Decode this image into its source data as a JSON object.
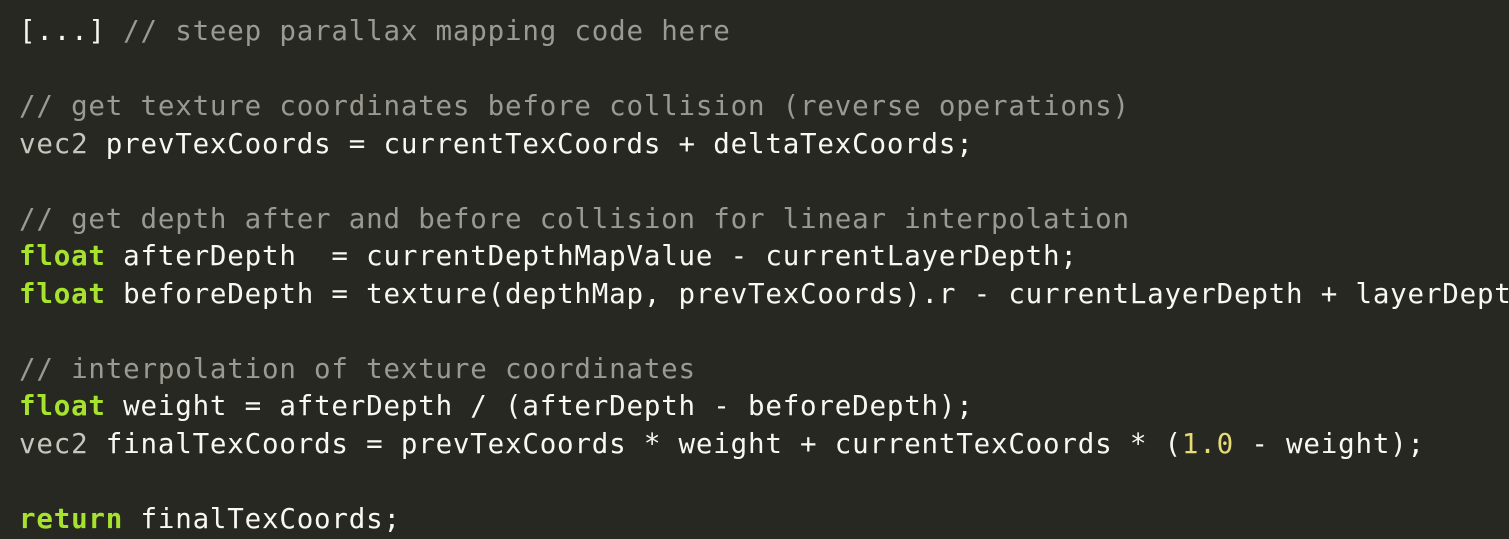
{
  "code_view": {
    "theme": {
      "background": "#272822",
      "comment": "#9a9a92",
      "type": "#c6c6bc",
      "keyword": "#a6e22e",
      "number": "#e6db74",
      "text": "#f8f8f2"
    },
    "lines": [
      [
        {
          "t": "[...] ",
          "k": "plain"
        },
        {
          "t": "// steep parallax mapping code here",
          "k": "comment"
        }
      ],
      [],
      [
        {
          "t": "// get texture coordinates before collision (reverse operations)",
          "k": "comment"
        }
      ],
      [
        {
          "t": "vec2",
          "k": "type"
        },
        {
          "t": " prevTexCoords = currentTexCoords + deltaTexCoords;",
          "k": "plain"
        }
      ],
      [],
      [
        {
          "t": "// get depth after and before collision for linear interpolation",
          "k": "comment"
        }
      ],
      [
        {
          "t": "float",
          "k": "kw"
        },
        {
          "t": " afterDepth  = currentDepthMapValue - currentLayerDepth;",
          "k": "plain"
        }
      ],
      [
        {
          "t": "float",
          "k": "kw"
        },
        {
          "t": " beforeDepth = texture(depthMap, prevTexCoords).r - currentLayerDepth + layerDepth;",
          "k": "plain"
        }
      ],
      [],
      [
        {
          "t": "// interpolation of texture coordinates",
          "k": "comment"
        }
      ],
      [
        {
          "t": "float",
          "k": "kw"
        },
        {
          "t": " weight = afterDepth / (afterDepth - beforeDepth);",
          "k": "plain"
        }
      ],
      [
        {
          "t": "vec2",
          "k": "type"
        },
        {
          "t": " finalTexCoords = prevTexCoords * weight + currentTexCoords * (",
          "k": "plain"
        },
        {
          "t": "1.0",
          "k": "num"
        },
        {
          "t": " - weight);",
          "k": "plain"
        }
      ],
      [],
      [
        {
          "t": "return",
          "k": "kw"
        },
        {
          "t": " finalTexCoords;",
          "k": "plain"
        }
      ]
    ]
  }
}
